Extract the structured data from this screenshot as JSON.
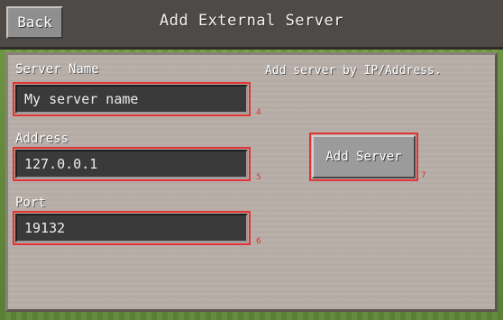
{
  "header": {
    "back_label": "Back",
    "title": "Add External Server"
  },
  "form": {
    "server_name": {
      "label": "Server Name",
      "value": "My server name",
      "marker": "4"
    },
    "address": {
      "label": "Address",
      "value": "127.0.0.1",
      "marker": "5"
    },
    "port": {
      "label": "Port",
      "value": "19132",
      "marker": "6"
    },
    "hint": "Add server by IP/Address.",
    "add_button_label": "Add Server",
    "add_button_marker": "7"
  },
  "colors": {
    "highlight": "#e23232",
    "panel": "#b8aea8",
    "header": "#4e4a47"
  }
}
